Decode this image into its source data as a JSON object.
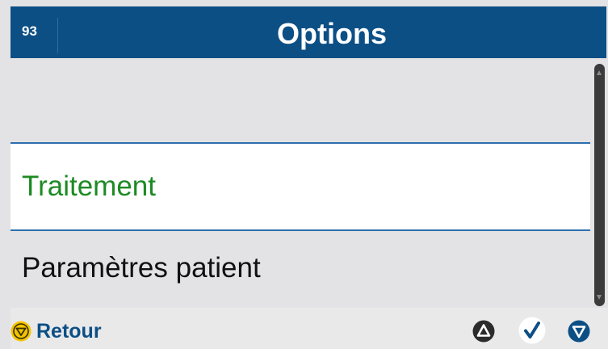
{
  "header": {
    "screen_number": "93",
    "title": "Options"
  },
  "menu": {
    "items": [
      {
        "label": ""
      },
      {
        "label": "Traitement",
        "selected": true
      },
      {
        "label": "Paramètres patient"
      }
    ]
  },
  "footer": {
    "back_label": "Retour"
  },
  "colors": {
    "header_bg": "#0c4f85",
    "selected_text": "#1d8a24",
    "back_icon": "#f2c400"
  },
  "icons": {
    "back": "stop-circle-yellow-icon",
    "up": "triangle-up-icon",
    "confirm": "checkmark-icon",
    "down": "triangle-down-icon"
  }
}
